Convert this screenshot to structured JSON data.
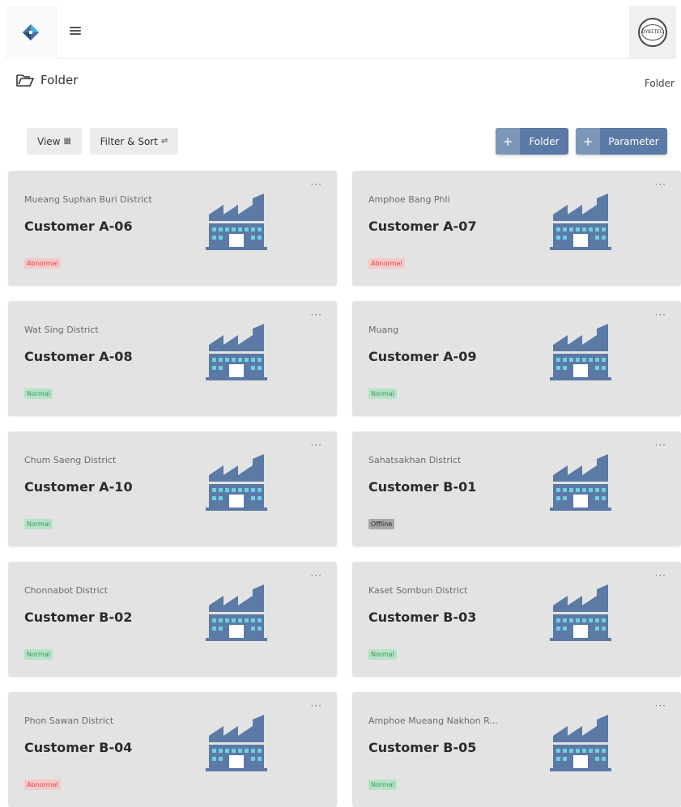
{
  "navbar": {
    "logo": "app-logo",
    "menu_icon": "hamburger-icon",
    "avatar_text": "DYBITECH"
  },
  "page": {
    "title": "Folder",
    "breadcrumb": "Folder"
  },
  "toolbar": {
    "view_label": "View",
    "view_glyph": "▦",
    "filter_label": "Filter & Sort",
    "filter_glyph": "⇌",
    "plus": "+",
    "folder_label": "Folder",
    "parameter_label": "Parameter"
  },
  "colors": {
    "accent": "#5b7aa5",
    "card_bg": "#e3e3e3",
    "abnormal": "#d84a4a",
    "normal": "#3e9a63",
    "offline": "#a7a7a7"
  },
  "cards": [
    {
      "location": "Mueang Suphan Buri District",
      "name": "Customer A-06",
      "status": "Abnormal",
      "menu": "···"
    },
    {
      "location": "Amphoe Bang Phli",
      "name": "Customer A-07",
      "status": "Abnormal",
      "menu": "···"
    },
    {
      "location": "Wat Sing District",
      "name": "Customer A-08",
      "status": "Normal",
      "menu": "···"
    },
    {
      "location": "Muang",
      "name": "Customer A-09",
      "status": "Normal",
      "menu": "···"
    },
    {
      "location": "Chum Saeng District",
      "name": "Customer A-10",
      "status": "Normal",
      "menu": "···"
    },
    {
      "location": "Sahatsakhan District",
      "name": "Customer B-01",
      "status": "Offline",
      "menu": "···"
    },
    {
      "location": "Chonnabot District",
      "name": "Customer B-02",
      "status": "Normal",
      "menu": "···"
    },
    {
      "location": "Kaset Sombun District",
      "name": "Customer B-03",
      "status": "Normal",
      "menu": "···"
    },
    {
      "location": "Phon Sawan District",
      "name": "Customer B-04",
      "status": "Abnormal",
      "menu": "···"
    },
    {
      "location": "Amphoe Mueang Nakhon R...",
      "name": "Customer B-05",
      "status": "Normal",
      "menu": "···"
    }
  ]
}
